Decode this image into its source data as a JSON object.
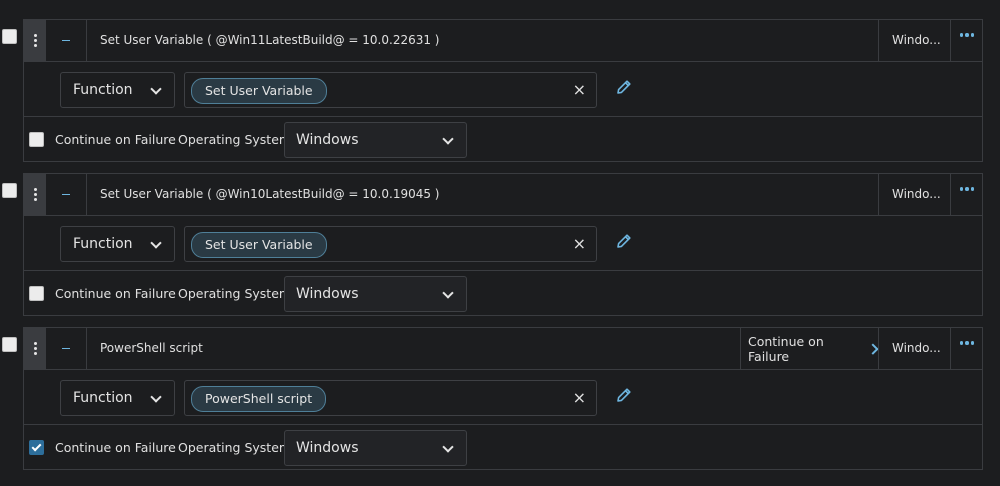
{
  "steps": [
    {
      "title": "Set User Variable ( @Win11LatestBuild@ = 10.0.22631 )",
      "header_continue_on_failure": "",
      "header_os": "Windo...",
      "function_type": "Function",
      "function_value": "Set User Variable",
      "clear_symbol": "×",
      "continue_on_failure_label": "Continue on Failure",
      "continue_on_failure_checked": false,
      "os_label": "Operating System:",
      "os_value": "Windows"
    },
    {
      "title": "Set User Variable ( @Win10LatestBuild@ = 10.0.19045 )",
      "header_continue_on_failure": "",
      "header_os": "Windo...",
      "function_type": "Function",
      "function_value": "Set User Variable",
      "clear_symbol": "×",
      "continue_on_failure_label": "Continue on Failure",
      "continue_on_failure_checked": false,
      "os_label": "Operating System:",
      "os_value": "Windows"
    },
    {
      "title": "PowerShell script",
      "header_continue_on_failure": "Continue on Failure",
      "header_os": "Windo...",
      "function_type": "Function",
      "function_value": "PowerShell script",
      "clear_symbol": "×",
      "continue_on_failure_label": "Continue on Failure",
      "continue_on_failure_checked": true,
      "os_label": "Operating System:",
      "os_value": "Windows"
    }
  ],
  "colors": {
    "background": "#1c1d1f",
    "border": "#3a3c40",
    "accent": "#6eb6e0",
    "chip_bg": "#2a3a44",
    "checked": "#2d6e9b"
  }
}
